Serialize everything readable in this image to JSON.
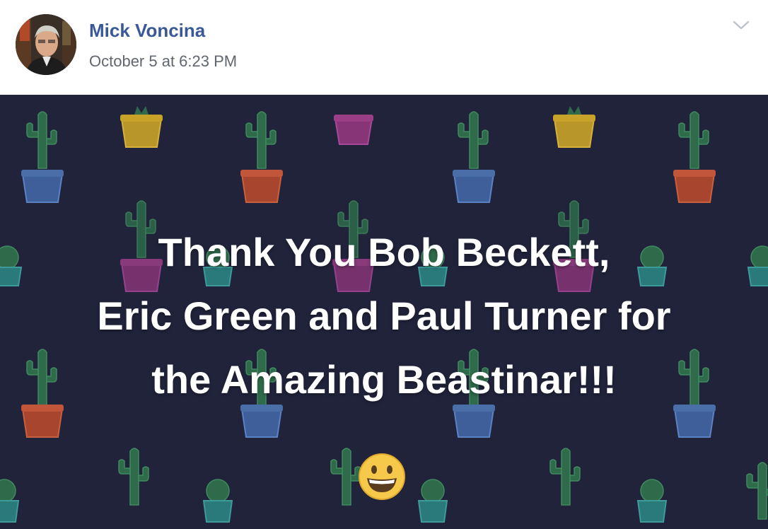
{
  "post": {
    "author": {
      "name": "Mick Voncina",
      "avatar_icon": "profile-photo"
    },
    "timestamp": "October 5 at 6:23 PM",
    "options_icon": "chevron-down-icon",
    "message_lines": [
      "Thank You Bob Beckett,",
      "Eric Green and Paul Turner for",
      "the Amazing Beastinar!!!"
    ],
    "emoji_icon": "grinning-face-emoji",
    "background": {
      "color": "#21233b",
      "pattern": "cactus-pots",
      "pot_colors": [
        "#4a6fa8",
        "#c2563a",
        "#9a3f86",
        "#c9a22a",
        "#2f8a8a"
      ],
      "cactus_color": "#2f6a4a"
    },
    "colors": {
      "author_name": "#385898",
      "timestamp": "#616770",
      "message_text": "#ffffff"
    }
  }
}
